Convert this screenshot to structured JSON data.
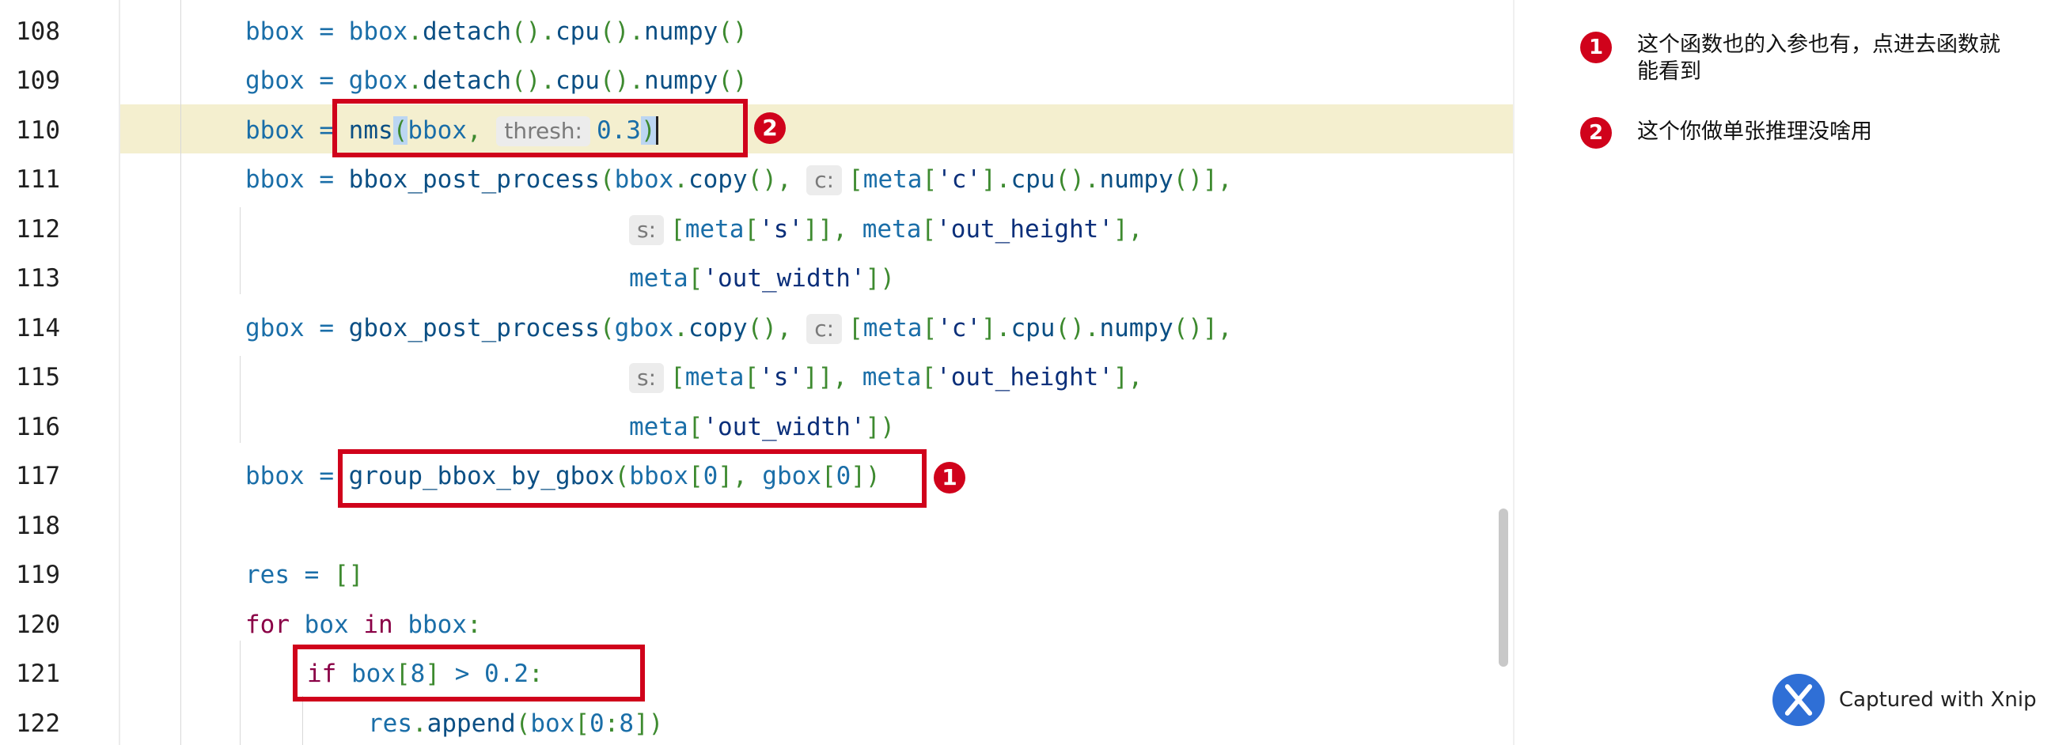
{
  "editor": {
    "lines": [
      {
        "num": "108"
      },
      {
        "num": "109"
      },
      {
        "num": "110"
      },
      {
        "num": "111"
      },
      {
        "num": "112"
      },
      {
        "num": "113"
      },
      {
        "num": "114"
      },
      {
        "num": "115"
      },
      {
        "num": "116"
      },
      {
        "num": "117"
      },
      {
        "num": "118"
      },
      {
        "num": "119"
      },
      {
        "num": "120"
      },
      {
        "num": "121"
      },
      {
        "num": "122"
      }
    ],
    "current_line": "110",
    "hints": {
      "thresh": "thresh:",
      "c": "c:",
      "s": "s:"
    }
  },
  "annotations": {
    "badge1": "1",
    "badge2": "2",
    "note1": "这个函数也的入参也有，点进去函数就能看到",
    "note2": "这个你做单张推理没啥用"
  },
  "watermark": {
    "text": "Captured with Xnip"
  },
  "colors": {
    "annotation_red": "#d0021b",
    "current_line_bg": "#f4efcf"
  }
}
